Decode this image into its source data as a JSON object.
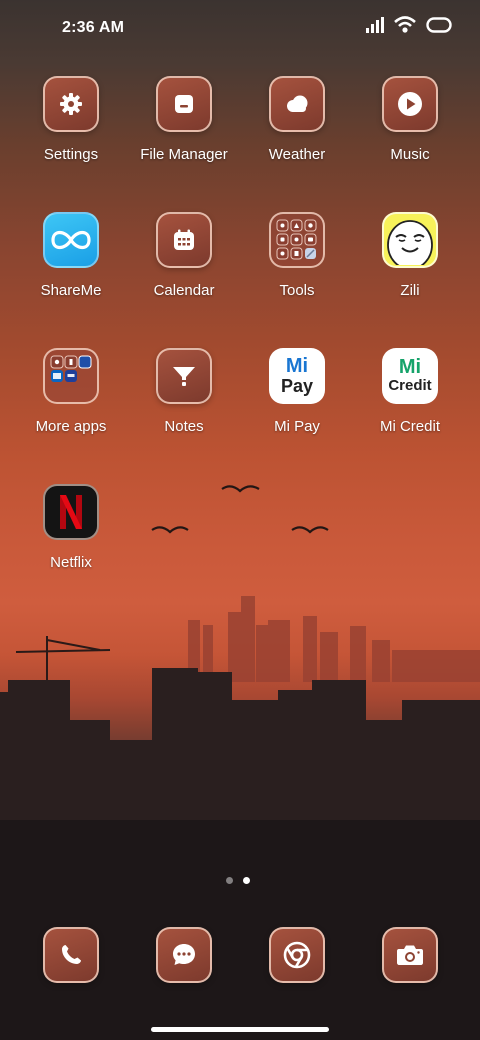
{
  "status_bar": {
    "time": "2:36 AM",
    "icons": [
      "signal-icon",
      "wifi-icon",
      "battery-icon"
    ]
  },
  "apps": [
    {
      "label": "Settings",
      "icon": "gear-icon"
    },
    {
      "label": "File Manager",
      "icon": "folder-icon"
    },
    {
      "label": "Weather",
      "icon": "cloud-icon"
    },
    {
      "label": "Music",
      "icon": "play-icon"
    },
    {
      "label": "ShareMe",
      "icon": "infinity-icon"
    },
    {
      "label": "Calendar",
      "icon": "calendar-icon"
    },
    {
      "label": "Tools",
      "icon": "tools-folder-icon"
    },
    {
      "label": "Zili",
      "icon": "zili-face-icon"
    },
    {
      "label": "More apps",
      "icon": "more-apps-folder-icon"
    },
    {
      "label": "Notes",
      "icon": "notes-icon"
    },
    {
      "label": "Mi Pay",
      "icon": "mi-pay-logo",
      "logo_text": [
        "Mi",
        "Pay"
      ]
    },
    {
      "label": "Mi Credit",
      "icon": "mi-credit-logo",
      "logo_text": [
        "Mi",
        "Credit"
      ]
    },
    {
      "label": "Netflix",
      "icon": "netflix-logo"
    }
  ],
  "dock": [
    {
      "icon": "phone-icon"
    },
    {
      "icon": "message-icon"
    },
    {
      "icon": "chrome-icon"
    },
    {
      "icon": "camera-icon"
    }
  ],
  "page_indicator": {
    "pages": 2,
    "current": 2
  },
  "colors": {
    "accent": "#a5523e",
    "netflix_red": "#e50914",
    "sky": "#cf5d3e"
  }
}
